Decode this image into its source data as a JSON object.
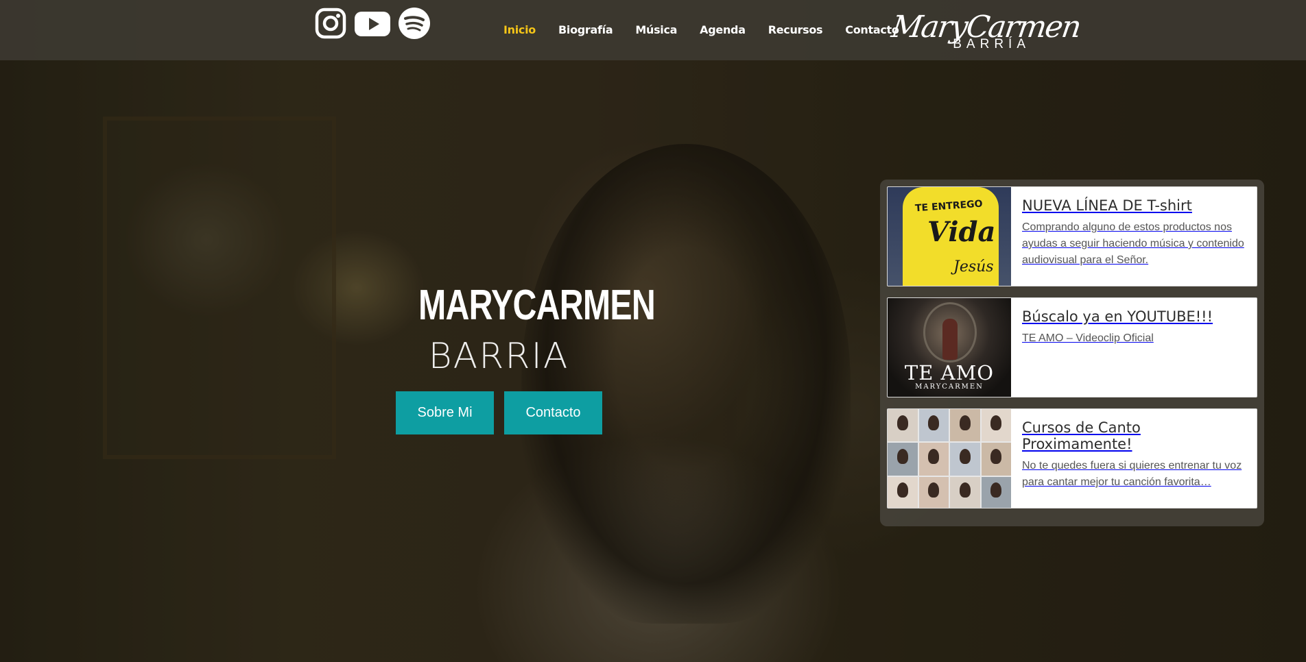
{
  "header": {
    "social": [
      {
        "name": "instagram-icon"
      },
      {
        "name": "youtube-icon"
      },
      {
        "name": "spotify-icon"
      }
    ],
    "nav": [
      {
        "label": "Inicio",
        "active": true
      },
      {
        "label": "Biografía",
        "active": false
      },
      {
        "label": "Música",
        "active": false
      },
      {
        "label": "Agenda",
        "active": false
      },
      {
        "label": "Recursos",
        "active": false
      },
      {
        "label": "Contacto",
        "active": false
      }
    ],
    "logo": {
      "script": "MaryCarmen",
      "sub": "BARRÍA"
    }
  },
  "hero": {
    "title": "MARYCARMEN",
    "subtitle": "BARRIA",
    "buttons": {
      "about": "Sobre Mi",
      "contact": "Contacto"
    }
  },
  "cards": [
    {
      "title": "NUEVA LÍNEA DE T-shirt",
      "description": "Comprando alguno de estos productos nos ayudas a seguir haciendo música y contenido audiovisual para el Señor.",
      "thumb": {
        "line1": "TE ENTREGO",
        "line2": "Vida",
        "line3": "Jesús"
      }
    },
    {
      "title": "Búscalo ya en YOUTUBE!!!",
      "description": "TE AMO – Videoclip Oficial",
      "thumb": {
        "title": "TE AMO",
        "sub": "MARYCARMEN"
      }
    },
    {
      "title": "Cursos de Canto Proximamente!",
      "description": "No te quedes fuera si quieres entrenar tu voz para cantar mejor tu canción favorita…"
    }
  ],
  "colors": {
    "accent": "#0e9ea2",
    "nav_active": "#f5c518",
    "header_bg": "#3e3a32"
  }
}
